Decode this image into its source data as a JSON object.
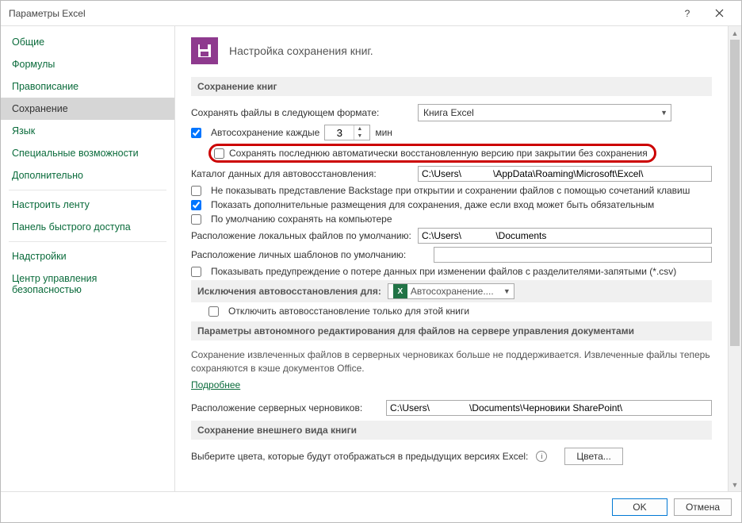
{
  "title": "Параметры Excel",
  "sidebar": {
    "items": [
      {
        "label": "Общие"
      },
      {
        "label": "Формулы"
      },
      {
        "label": "Правописание"
      },
      {
        "label": "Сохранение",
        "selected": true
      },
      {
        "label": "Язык"
      },
      {
        "label": "Специальные возможности"
      },
      {
        "label": "Дополнительно"
      },
      {
        "label": "Настроить ленту"
      },
      {
        "label": "Панель быстрого доступа"
      },
      {
        "label": "Надстройки"
      },
      {
        "label": "Центр управления безопасностью"
      }
    ]
  },
  "header": {
    "text": "Настройка сохранения книг."
  },
  "sections": {
    "save_books": "Сохранение книг",
    "autorecover_exc": "Исключения автовосстановления для:",
    "offline": "Параметры автономного редактирования для файлов на сервере управления документами",
    "appearance": "Сохранение внешнего вида книги"
  },
  "save": {
    "format_label": "Сохранять файлы в следующем формате:",
    "format_value": "Книга Excel",
    "autosave_label": "Автосохранение каждые",
    "autosave_minutes": "3",
    "minutes_unit": "мин",
    "keep_last_label": "Сохранять последнюю автоматически восстановленную версию при закрытии без сохранения",
    "recover_dir_label": "Каталог данных для автовосстановления:",
    "recover_dir_value": "C:\\Users\\            \\AppData\\Roaming\\Microsoft\\Excel\\",
    "no_backstage_label": "Не показывать представление Backstage при открытии и сохранении файлов с помощью сочетаний клавиш",
    "show_additional_label": "Показать дополнительные размещения для сохранения, даже если вход может быть обязательным",
    "default_computer_label": "По умолчанию сохранять на компьютере",
    "local_files_label": "Расположение локальных файлов по умолчанию:",
    "local_files_value": "C:\\Users\\             \\Documents",
    "templates_label": "Расположение личных шаблонов по умолчанию:",
    "templates_value": "",
    "csv_warning_label": "Показывать предупреждение о потере данных при изменении файлов с разделителями-запятыми (*.csv)"
  },
  "exc": {
    "workbook": "Автосохранение....",
    "disable_label": "Отключить автовосстановление только для этой книги"
  },
  "offline": {
    "text": "Сохранение извлеченных файлов в серверных черновиках больше не поддерживается. Извлеченные файлы теперь сохраняются в кэше документов Office.",
    "more": "Подробнее",
    "drafts_label": "Расположение серверных черновиков:",
    "drafts_value": "C:\\Users\\               \\Documents\\Черновики SharePoint\\"
  },
  "appearance": {
    "text": "Выберите цвета, которые будут отображаться в предыдущих версиях Excel:",
    "colors_btn": "Цвета..."
  },
  "footer": {
    "ok": "OK",
    "cancel": "Отмена"
  }
}
